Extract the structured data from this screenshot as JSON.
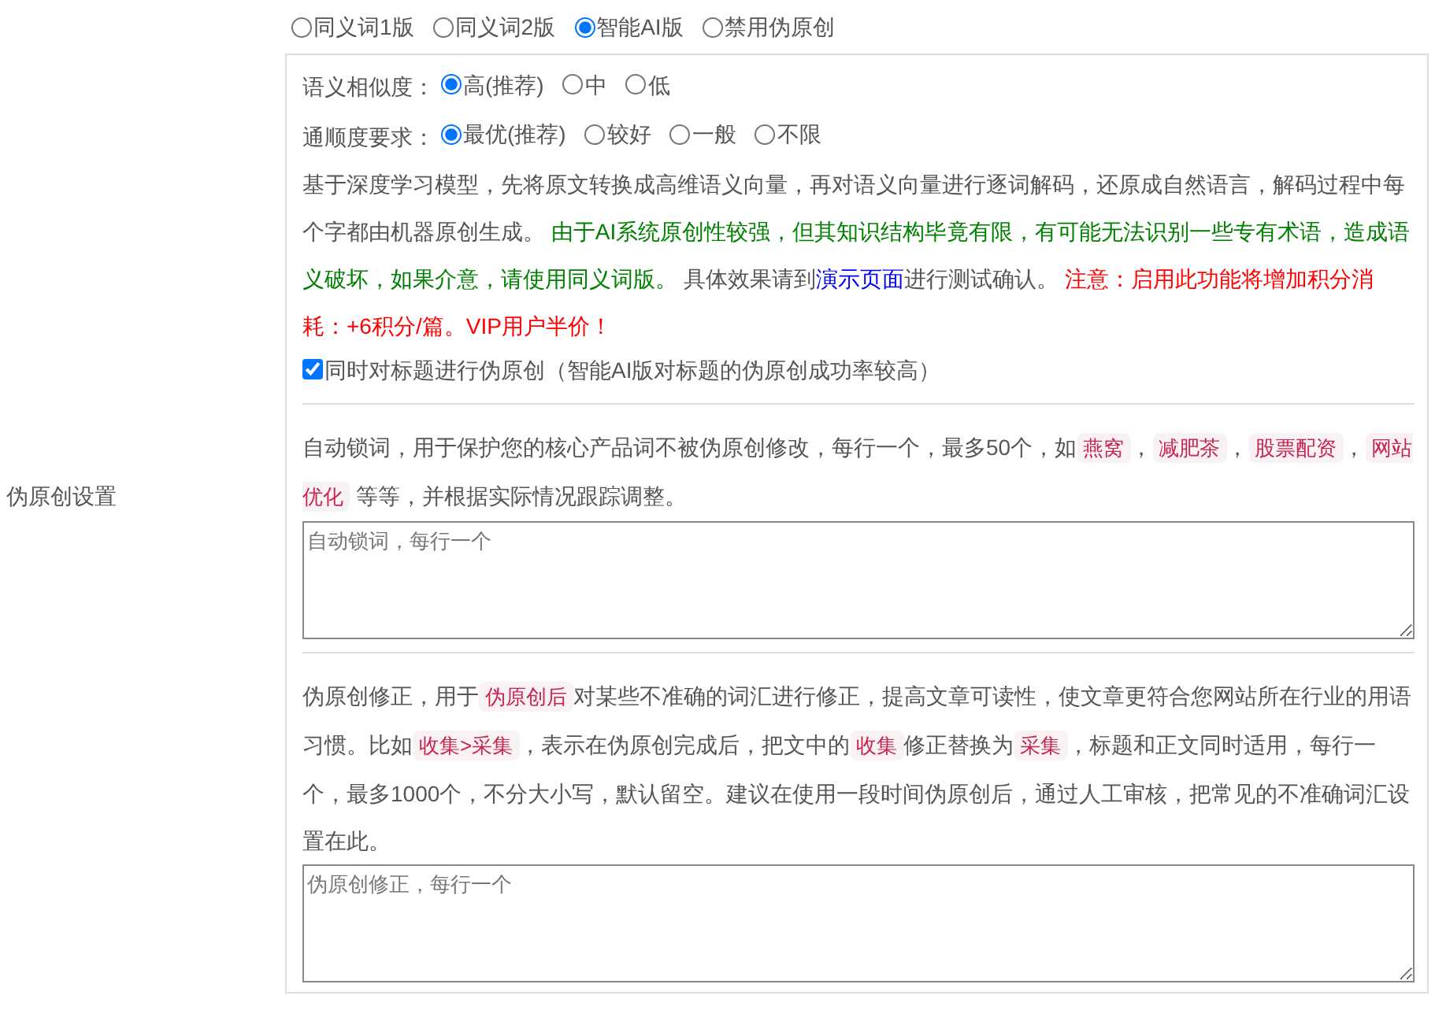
{
  "section_label": "伪原创设置",
  "modes": [
    {
      "label": "同义词1版",
      "selected": false
    },
    {
      "label": "同义词2版",
      "selected": false
    },
    {
      "label": "智能AI版",
      "selected": true
    },
    {
      "label": "禁用伪原创",
      "selected": false
    }
  ],
  "similarity": {
    "label": "语义相似度：",
    "options": [
      {
        "label": "高(推荐)",
        "selected": true
      },
      {
        "label": "中",
        "selected": false
      },
      {
        "label": "低",
        "selected": false
      }
    ]
  },
  "fluency": {
    "label": "通顺度要求：",
    "options": [
      {
        "label": "最优(推荐)",
        "selected": true
      },
      {
        "label": "较好",
        "selected": false
      },
      {
        "label": "一般",
        "selected": false
      },
      {
        "label": "不限",
        "selected": false
      }
    ]
  },
  "ai_description": [
    {
      "kind": "plain",
      "text": "基于深度学习模型，先将原文转换成高维语义向量，再对语义向量进行逐词解码，还原成自然语言，解码过程中每个字都由机器原创生成。 "
    },
    {
      "kind": "notice",
      "text": "由于AI系统原创性较强，但其知识结构毕竟有限，有可能无法识别一些专有术语，造成语义破坏，如果介意，请使用同义词版。"
    },
    {
      "kind": "plain",
      "text": " 具体效果请到"
    },
    {
      "kind": "link",
      "text": "演示页面"
    },
    {
      "kind": "plain",
      "text": "进行测试确认。 "
    },
    {
      "kind": "warning",
      "text": "注意：启用此功能将增加积分消耗：+6积分/篇。VIP用户半价！"
    }
  ],
  "title_option": {
    "label": "同时对标题进行伪原创（智能AI版对标题的伪原创成功率较高）",
    "checked": true
  },
  "lock_words": {
    "description": [
      {
        "kind": "plain",
        "text": "自动锁词，用于保护您的核心产品词不被伪原创修改，每行一个，最多50个，如"
      },
      {
        "kind": "code",
        "text": "燕窝"
      },
      {
        "kind": "plain",
        "text": "，"
      },
      {
        "kind": "code",
        "text": "减肥茶"
      },
      {
        "kind": "plain",
        "text": "，"
      },
      {
        "kind": "code",
        "text": "股票配资"
      },
      {
        "kind": "plain",
        "text": "，"
      },
      {
        "kind": "code",
        "text": "网站优化"
      },
      {
        "kind": "plain",
        "text": " 等等，并根据实际情况跟踪调整。"
      }
    ],
    "placeholder": "自动锁词，每行一个"
  },
  "corrections": {
    "description": [
      {
        "kind": "plain",
        "text": "伪原创修正，用于"
      },
      {
        "kind": "code",
        "text": "伪原创后"
      },
      {
        "kind": "plain",
        "text": "对某些不准确的词汇进行修正，提高文章可读性，使文章更符合您网站所在行业的用语习惯。比如"
      },
      {
        "kind": "code",
        "text": "收集>采集"
      },
      {
        "kind": "plain",
        "text": "，表示在伪原创完成后，把文中的"
      },
      {
        "kind": "code",
        "text": "收集"
      },
      {
        "kind": "plain",
        "text": "修正替换为"
      },
      {
        "kind": "code",
        "text": "采集"
      },
      {
        "kind": "plain",
        "text": "，标题和正文同时适用，每行一个，最多1000个，不分大小写，默认留空。建议在使用一段时间伪原创后，通过人工审核，把常见的不准确词汇设置在此。"
      }
    ],
    "placeholder": "伪原创修正，每行一个"
  }
}
